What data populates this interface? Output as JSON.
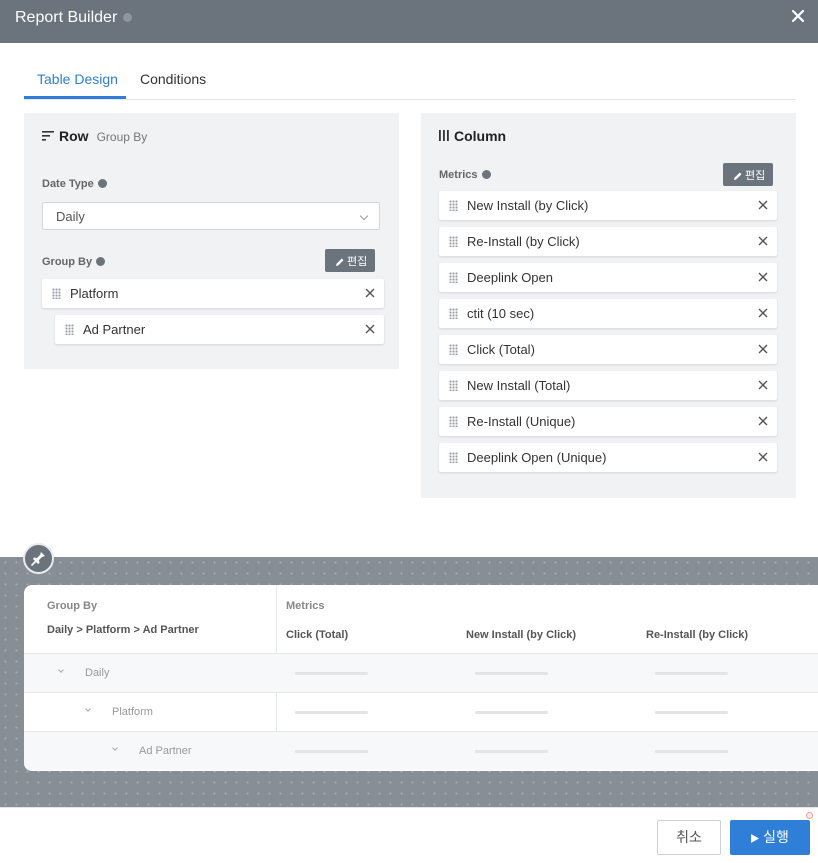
{
  "dialog": {
    "title": "Report Builder",
    "close_icon": "close-icon"
  },
  "tabs": [
    {
      "label": "Table Design",
      "active": true
    },
    {
      "label": "Conditions",
      "active": false
    }
  ],
  "row_panel": {
    "title": "Row",
    "subtitle": "Group By",
    "date_type": {
      "label": "Date Type",
      "value": "Daily"
    },
    "group_by": {
      "label": "Group By",
      "edit_label": "편집",
      "items": [
        "Platform",
        "Ad Partner"
      ]
    }
  },
  "column_panel": {
    "title": "Column",
    "metrics": {
      "label": "Metrics",
      "edit_label": "편집",
      "items": [
        "New Install (by Click)",
        "Re-Install (by Click)",
        "Deeplink Open",
        "ctit (10 sec)",
        "Click (Total)",
        "New Install (Total)",
        "Re-Install (Unique)",
        "Deeplink Open (Unique)"
      ]
    }
  },
  "preview": {
    "group_by_label": "Group By",
    "group_by_path": "Daily > Platform > Ad Partner",
    "metrics_label": "Metrics",
    "metric_columns": [
      "Click (Total)",
      "New Install (by Click)",
      "Re-Install (by Click)"
    ],
    "rows": [
      "Daily",
      "Platform",
      "Ad Partner"
    ]
  },
  "footer": {
    "cancel_label": "취소",
    "run_label": "실행"
  },
  "colors": {
    "accent": "#2f7ed8",
    "titlebar": "#6b737d",
    "panel": "#f1f2f4"
  }
}
